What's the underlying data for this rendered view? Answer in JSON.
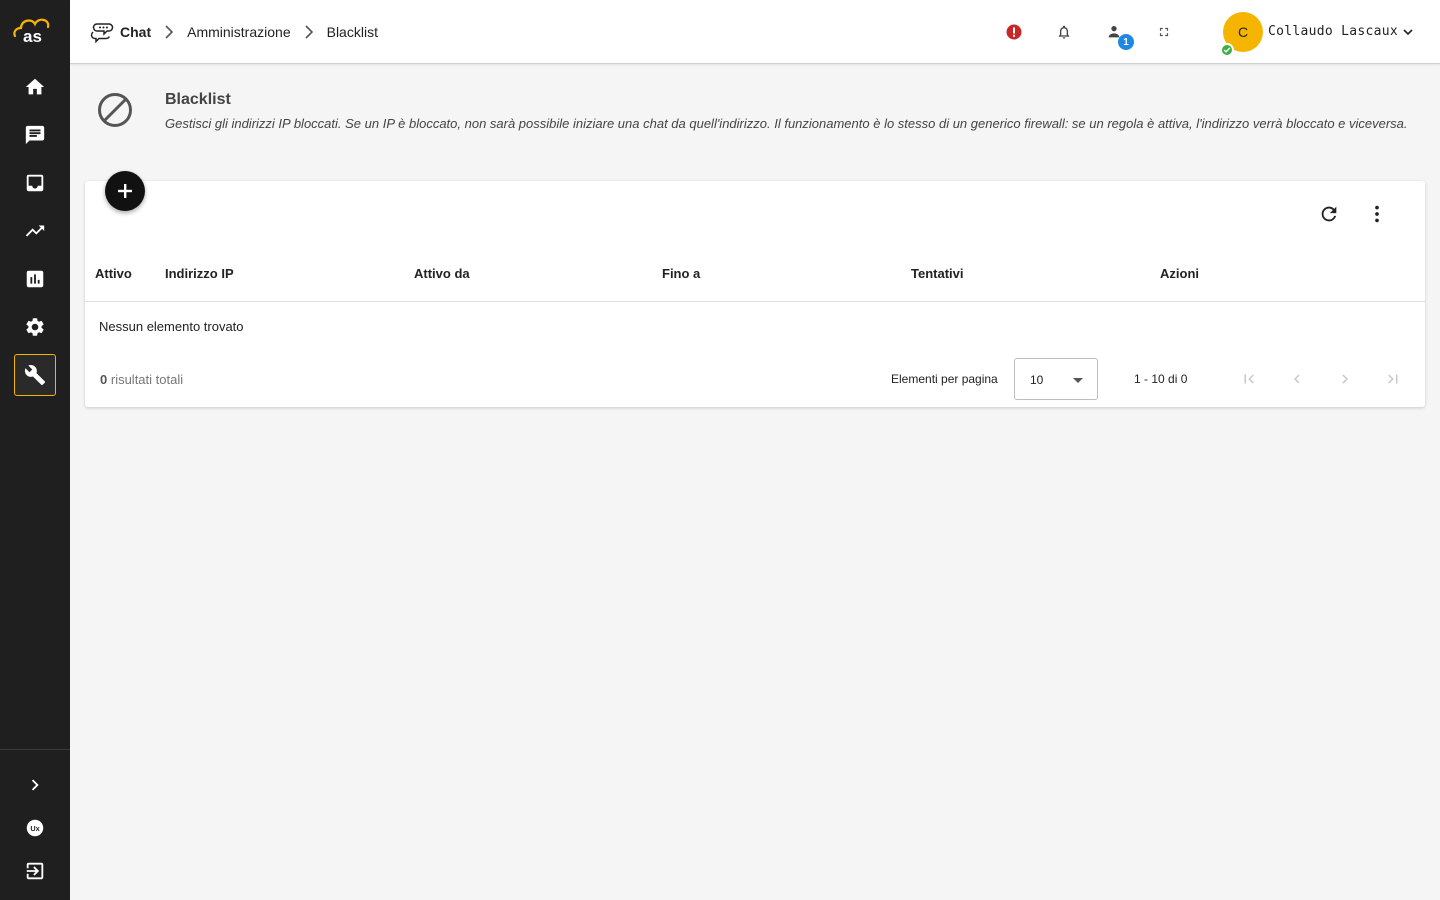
{
  "app": {
    "logo_text": "as"
  },
  "sidebar": {
    "items": [
      {
        "name": "home",
        "icon": "home-icon"
      },
      {
        "name": "chat",
        "icon": "chat-icon"
      },
      {
        "name": "inbox",
        "icon": "inbox-icon"
      },
      {
        "name": "trending",
        "icon": "trending-up-icon"
      },
      {
        "name": "reports",
        "icon": "bar-chart-icon"
      },
      {
        "name": "settings",
        "icon": "gear-icon"
      },
      {
        "name": "tools",
        "icon": "wrench-icon",
        "active": true
      }
    ],
    "bottom": [
      {
        "name": "expand",
        "icon": "chevron-right-icon"
      },
      {
        "name": "ux",
        "icon": "ux-icon"
      },
      {
        "name": "logout",
        "icon": "logout-icon"
      }
    ],
    "accent_color": "#f5b400"
  },
  "breadcrumb": {
    "items": [
      "Chat",
      "Amministrazione",
      "Blacklist"
    ]
  },
  "topbar": {
    "icons": [
      "alert-icon",
      "bell-icon",
      "users-online-icon",
      "fullscreen-icon"
    ],
    "online_badge": "1",
    "user": {
      "initial": "C",
      "name": "Collaudo Lascaux",
      "status_color": "#3cb043",
      "avatar_color": "#f5b400"
    }
  },
  "page": {
    "title": "Blacklist",
    "description": "Gestisci gli indirizzi IP bloccati. Se un IP è bloccato, non sarà possibile iniziare una chat da quell'indirizzo. Il funzionamento è lo stesso di un generico firewall: se un regola è attiva, l'indirizzo verrà bloccato e viceversa."
  },
  "table": {
    "columns": [
      "Attivo",
      "Indirizzo IP",
      "Attivo da",
      "Fino a",
      "Tentativi",
      "Azioni"
    ],
    "rows": [],
    "empty_text": "Nessun elemento trovato",
    "total_count": "0",
    "total_label": "risultati totali",
    "per_page_label": "Elementi per pagina",
    "per_page_value": "10",
    "range_text": "1 - 10 di 0"
  }
}
